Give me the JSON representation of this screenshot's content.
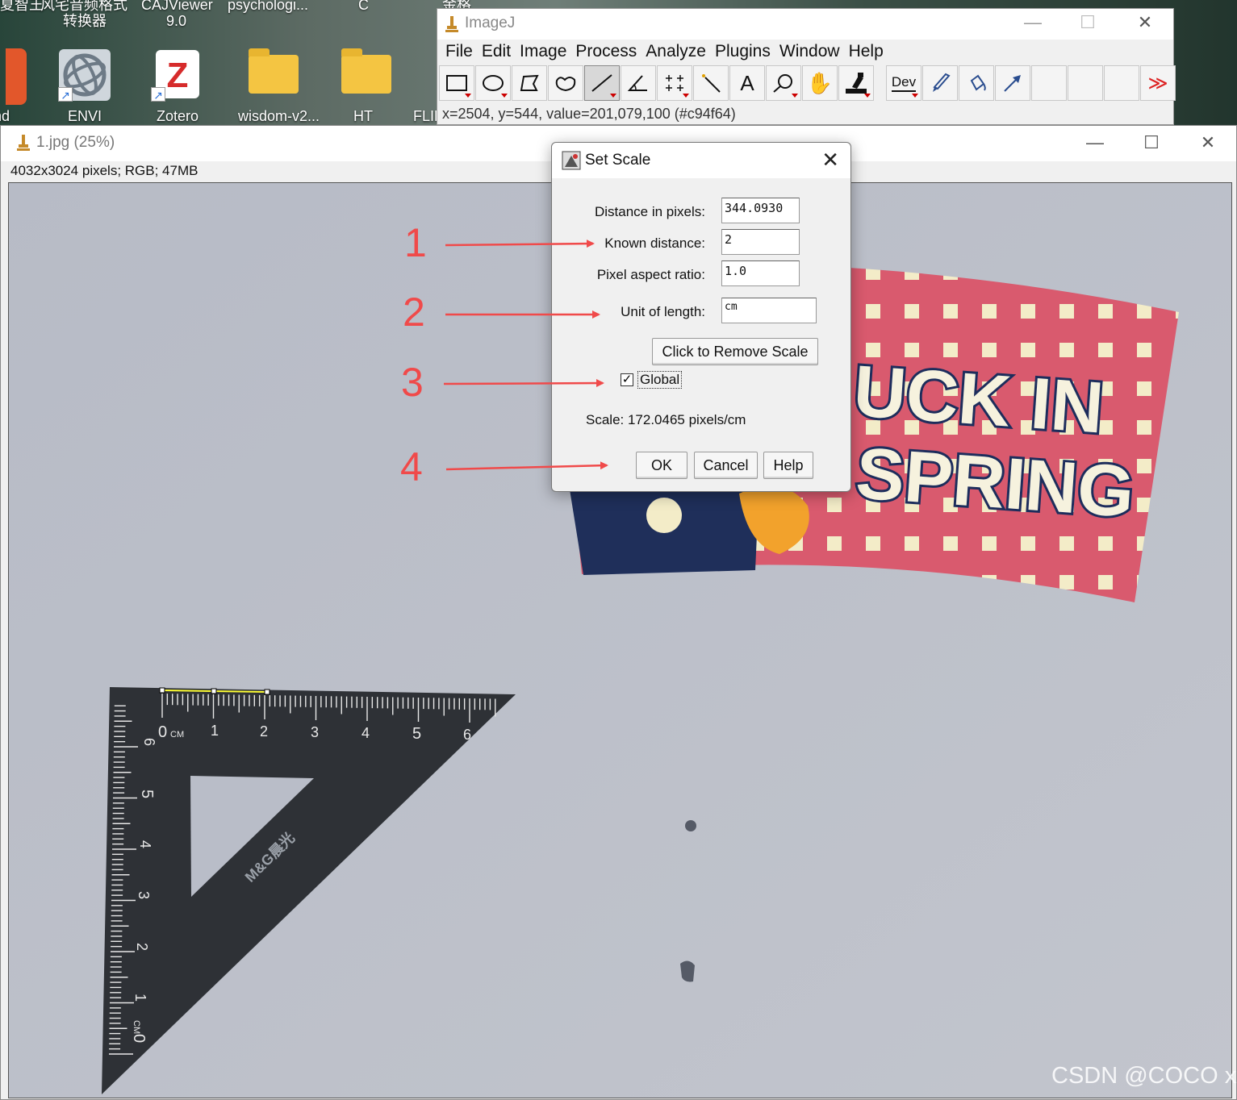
{
  "desktop": {
    "top_labels": [
      {
        "text": "夏智王"
      },
      {
        "text": "风宅音频格式"
      },
      {
        "text": "转换器"
      },
      {
        "text": "CAJViewer"
      },
      {
        "text": "9.0"
      },
      {
        "text": "psychologi..."
      },
      {
        "text": "C"
      },
      {
        "text": "金格"
      }
    ],
    "icons": [
      {
        "label": "nd"
      },
      {
        "label": "ENVI"
      },
      {
        "label": "Zotero"
      },
      {
        "label": "wisdom-v2..."
      },
      {
        "label": "HT"
      },
      {
        "label": "FLIP"
      }
    ]
  },
  "imagej": {
    "title": "ImageJ",
    "menu": [
      "File",
      "Edit",
      "Image",
      "Process",
      "Analyze",
      "Plugins",
      "Window",
      "Help"
    ],
    "tools": [
      {
        "name": "rectangle-tool-icon"
      },
      {
        "name": "oval-tool-icon"
      },
      {
        "name": "polygon-tool-icon"
      },
      {
        "name": "freehand-tool-icon"
      },
      {
        "name": "line-tool-icon"
      },
      {
        "name": "angle-tool-icon"
      },
      {
        "name": "point-tool-icon"
      },
      {
        "name": "wand-tool-icon"
      },
      {
        "name": "text-tool-icon"
      },
      {
        "name": "magnifier-tool-icon"
      },
      {
        "name": "hand-tool-icon"
      },
      {
        "name": "color-picker-tool-icon"
      },
      {
        "name": "dev-tool-icon",
        "text": "Dev"
      },
      {
        "name": "brush-tool-icon"
      },
      {
        "name": "flood-fill-tool-icon"
      },
      {
        "name": "arrow-tool-icon"
      },
      {
        "name": "empty-slot-icon"
      },
      {
        "name": "empty-slot-icon"
      },
      {
        "name": "empty-slot-icon"
      },
      {
        "name": "more-tools-icon",
        "text": "≫"
      }
    ],
    "status": "x=2504, y=544, value=201,079,100 (#c94f64)"
  },
  "image_window": {
    "title": "1.jpg (25%)",
    "info": "4032x3024 pixels; RGB; 47MB",
    "photo_text": {
      "headline_1": "UCK IN",
      "headline_2": "SPRING",
      "ruler_brand": "M&G晨光",
      "ruler_top_ticks": [
        "0",
        "CM",
        "1",
        "2",
        "3",
        "4",
        "5",
        "6"
      ],
      "ruler_side_ticks": [
        "6",
        "5",
        "4",
        "3",
        "2",
        "1",
        "0",
        "CM"
      ]
    }
  },
  "set_scale": {
    "title": "Set Scale",
    "distance_label": "Distance in pixels:",
    "distance_value": "344.0930",
    "known_label": "Known distance:",
    "known_value": "2",
    "aspect_label": "Pixel aspect ratio:",
    "aspect_value": "1.0",
    "unit_label": "Unit of length:",
    "unit_value": "cm",
    "remove_button": "Click to Remove Scale",
    "global_label": "Global",
    "global_checked": true,
    "scale_text": "Scale: 172.0465 pixels/cm",
    "ok": "OK",
    "cancel": "Cancel",
    "help": "Help"
  },
  "annotations": {
    "steps": [
      "1",
      "2",
      "3",
      "4"
    ],
    "color": "#f04a4a"
  },
  "watermark": "CSDN @COCO xx"
}
